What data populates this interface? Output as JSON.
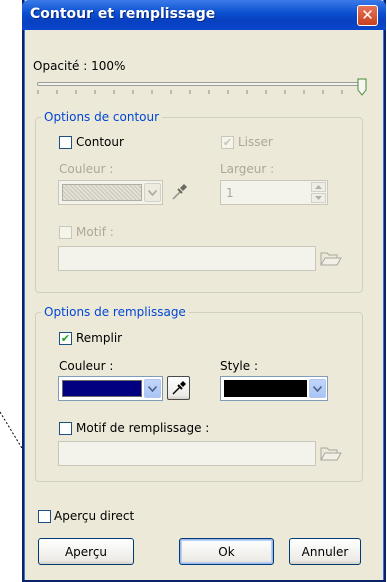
{
  "window": {
    "title": "Contour et remplissage",
    "close_glyph": "✕"
  },
  "opacity": {
    "label": "Opacité : 100%",
    "value_percent": 100
  },
  "contour_group": {
    "title": "Options de contour",
    "contour_label": "Contour",
    "contour_checked": false,
    "lisser_label": "Lisser",
    "lisser_checked": true,
    "couleur_label": "Couleur :",
    "largeur_label": "Largeur :",
    "largeur_value": "1",
    "motif_label": "Motif :",
    "motif_checked": false
  },
  "fill_group": {
    "title": "Options de remplissage",
    "remplir_label": "Remplir",
    "remplir_checked": true,
    "couleur_label": "Couleur :",
    "couleur_value_color": "#000080",
    "style_label": "Style :",
    "style_value_color": "#000000",
    "motif_label": "Motif de remplissage :",
    "motif_checked": false
  },
  "preview": {
    "live_label": "Aperçu direct",
    "live_checked": false
  },
  "buttons": {
    "apercu": "Aperçu",
    "ok": "Ok",
    "annuler": "Annuler"
  },
  "icons": {
    "eyedropper": "eyedropper-icon",
    "folder": "folder-open-icon"
  }
}
